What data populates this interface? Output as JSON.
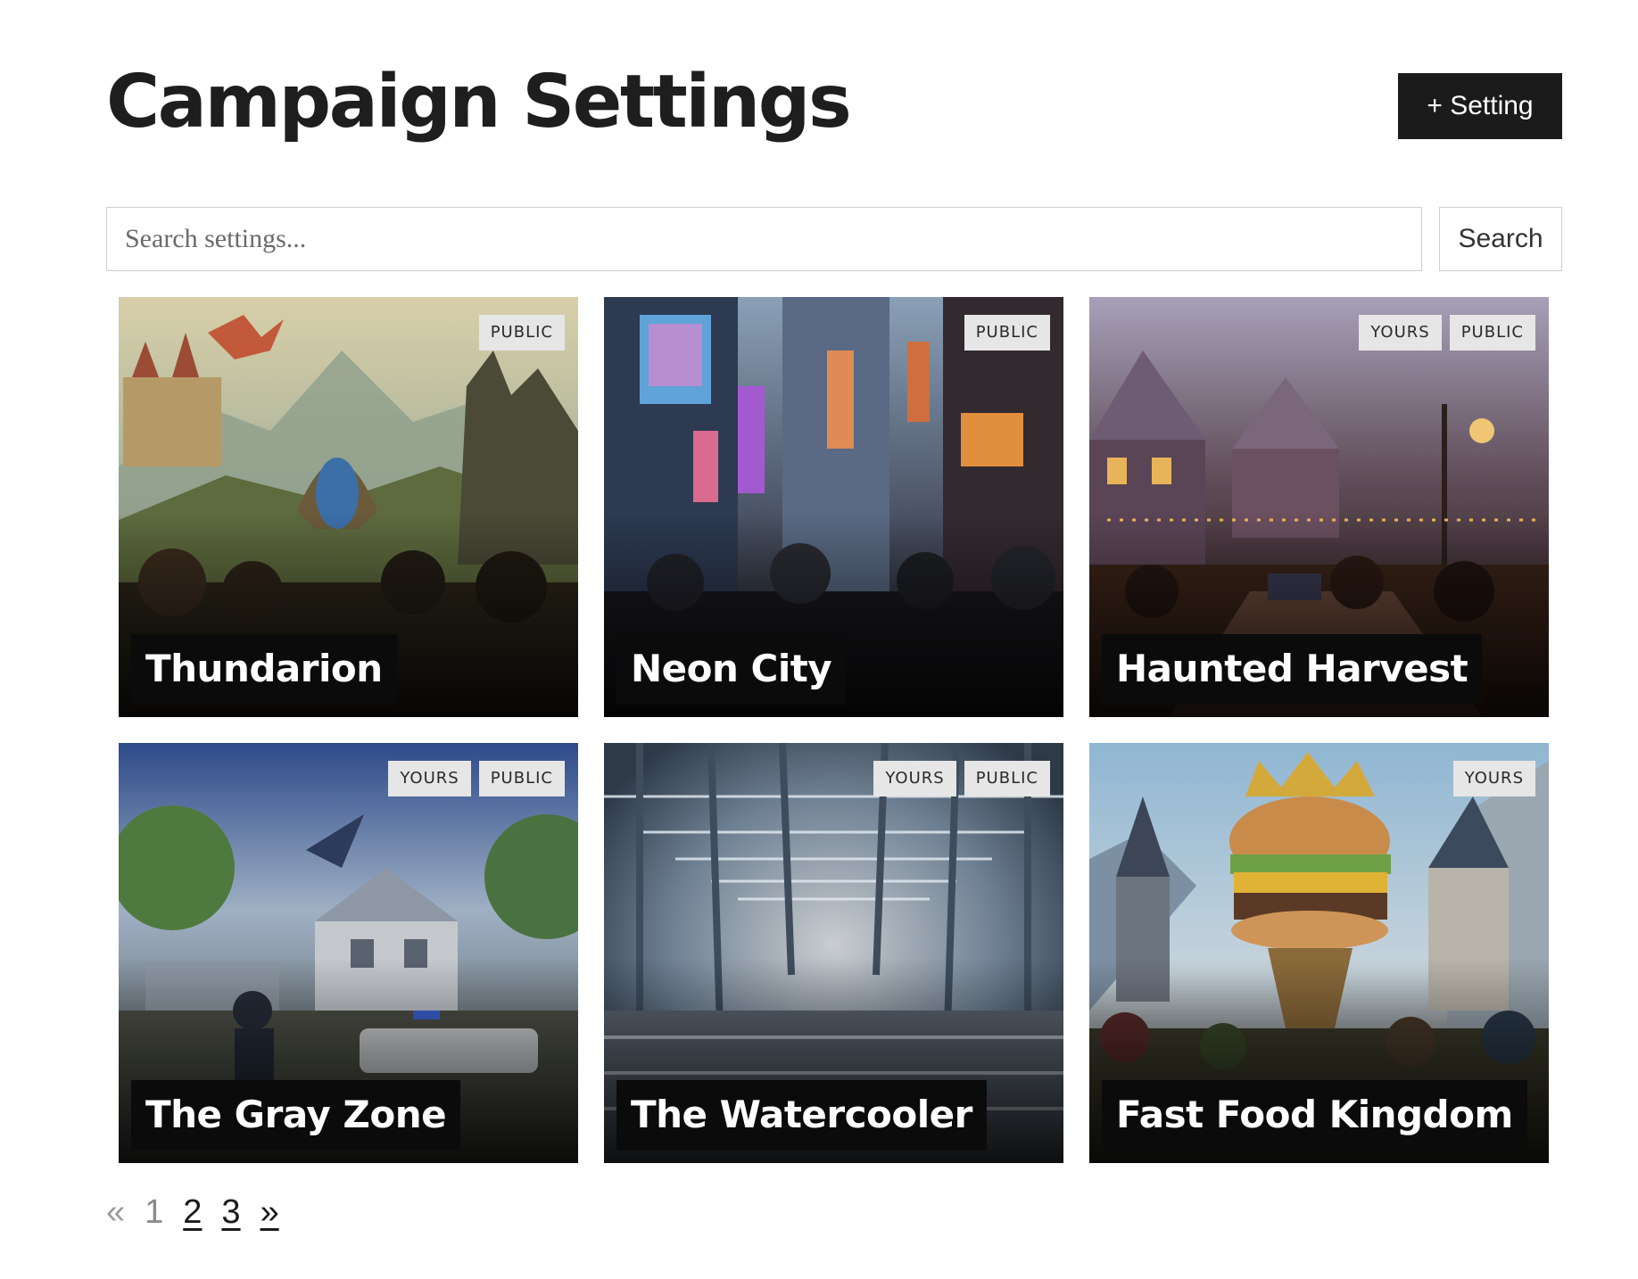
{
  "header": {
    "title": "Campaign Settings",
    "add_label": "+ Setting"
  },
  "search": {
    "placeholder": "Search settings...",
    "value": "",
    "button_label": "Search"
  },
  "cards": [
    {
      "title": "Thundarion",
      "badges": [
        "PUBLIC"
      ],
      "art": "fantasy-castle-dragon-landscape"
    },
    {
      "title": "Neon City",
      "badges": [
        "PUBLIC"
      ],
      "art": "cyberpunk-street-crowd"
    },
    {
      "title": "Haunted Harvest",
      "badges": [
        "YOURS",
        "PUBLIC"
      ],
      "art": "halloween-town-street"
    },
    {
      "title": "The Gray Zone",
      "badges": [
        "YOURS",
        "PUBLIC"
      ],
      "art": "suburban-house-ufo-night"
    },
    {
      "title": "The Watercooler",
      "badges": [
        "YOURS",
        "PUBLIC"
      ],
      "art": "endless-office-cubicles"
    },
    {
      "title": "Fast Food Kingdom",
      "badges": [
        "YOURS"
      ],
      "art": "crowned-burger-village"
    }
  ],
  "pagination": {
    "prev": "«",
    "pages": [
      "1",
      "2",
      "3"
    ],
    "current": "1",
    "next": "»"
  }
}
